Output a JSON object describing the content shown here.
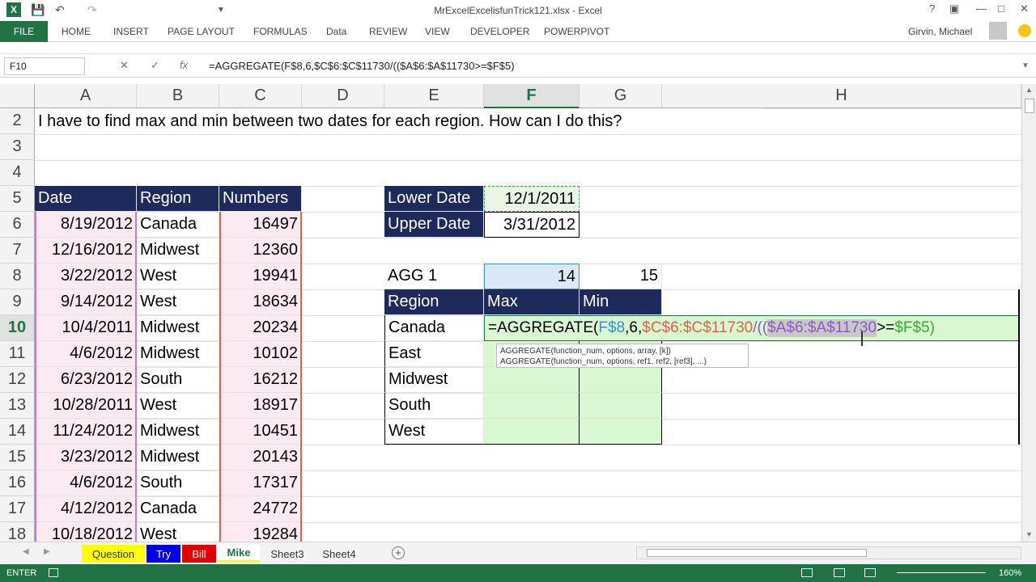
{
  "window": {
    "title": "MrExcelExcelisfunTrick121.xlsx - Excel",
    "user": "Girvin, Michael"
  },
  "ribbon": {
    "file": "FILE",
    "tabs": [
      "HOME",
      "INSERT",
      "PAGE LAYOUT",
      "FORMULAS",
      "Data",
      "REVIEW",
      "VIEW",
      "DEVELOPER",
      "POWERPIVOT"
    ]
  },
  "formula_bar": {
    "name_box": "F10",
    "fx": "fx",
    "formula": "=AGGREGATE(F$8,6,$C$6:$C$11730/(($A$6:$A$11730>=$F$5)"
  },
  "columns": [
    "A",
    "B",
    "C",
    "D",
    "E",
    "F",
    "G",
    "H"
  ],
  "rows": [
    "2",
    "3",
    "4",
    "5",
    "6",
    "7",
    "8",
    "9",
    "10",
    "11",
    "12",
    "13",
    "14",
    "15",
    "16",
    "17",
    "18"
  ],
  "question": "I have to find max and min between two dates for each region. How can I do this?",
  "table_headers": [
    "Date",
    "Region",
    "Numbers"
  ],
  "table_rows": [
    [
      "8/19/2012",
      "Canada",
      "16497"
    ],
    [
      "12/16/2012",
      "Midwest",
      "12360"
    ],
    [
      "3/22/2012",
      "West",
      "19941"
    ],
    [
      "9/14/2012",
      "West",
      "18634"
    ],
    [
      "10/4/2011",
      "Midwest",
      "20234"
    ],
    [
      "4/6/2012",
      "Midwest",
      "10102"
    ],
    [
      "6/23/2012",
      "South",
      "16212"
    ],
    [
      "10/28/2011",
      "West",
      "18917"
    ],
    [
      "11/24/2012",
      "Midwest",
      "10451"
    ],
    [
      "3/23/2012",
      "Midwest",
      "20143"
    ],
    [
      "4/6/2012",
      "South",
      "17317"
    ],
    [
      "4/12/2012",
      "Canada",
      "24772"
    ],
    [
      "10/18/2012",
      "West",
      "19284"
    ]
  ],
  "criteria": {
    "lower_label": "Lower Date",
    "lower_value": "12/1/2011",
    "upper_label": "Upper Date",
    "upper_value": "3/31/2012"
  },
  "agg": {
    "label": "AGG 1",
    "f_value": "14",
    "g_value": "15"
  },
  "result_headers": [
    "Region",
    "Max",
    "Min"
  ],
  "result_regions": [
    "Canada",
    "East",
    "Midwest",
    "South",
    "West"
  ],
  "editing_formula": {
    "p1": "=AGGREGATE(",
    "p2": "F$8",
    "p3": ",6,",
    "p4": "$C$6:$C$11730",
    "p5": "/((",
    "p6": "$A$6:$A$11730",
    "p7": ">=",
    "p8": "$F$5",
    "p9": ")"
  },
  "tooltip": {
    "line1": "AGGREGATE(function_num, options, array, [k])",
    "line2": "AGGREGATE(function_num, options, ref1, ref2, [ref3], ...)"
  },
  "sheets": [
    "Question",
    "Try",
    "Bill",
    "Mike",
    "Sheet3",
    "Sheet4"
  ],
  "status": {
    "mode": "ENTER",
    "zoom": "160%"
  },
  "colors": {
    "excel_green": "#217346",
    "header_navy": "#1f2a5c",
    "range_blue": "#3b8fd6",
    "range_red": "#e0614a",
    "range_purple": "#8a5ac8",
    "range_green": "#3aa935"
  }
}
